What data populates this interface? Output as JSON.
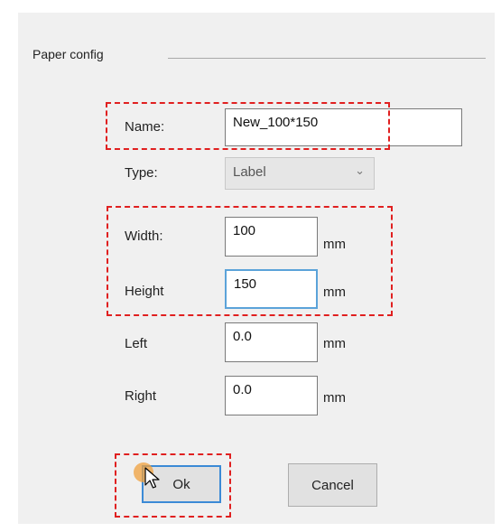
{
  "group": {
    "title": "Paper config"
  },
  "form": {
    "name_label": "Name:",
    "name_value": "New_100*150",
    "type_label": "Type:",
    "type_value": "Label",
    "width_label": "Width:",
    "width_value": "100",
    "height_label": "Height",
    "height_value": "150",
    "left_label": "Left",
    "left_value": "0.0",
    "right_label": "Right",
    "right_value": "0.0",
    "unit": "mm"
  },
  "buttons": {
    "ok": "Ok",
    "cancel": "Cancel"
  },
  "colors": {
    "highlight": "#e02020",
    "focus": "#5ba3d9",
    "cursor": "#f0a03c"
  },
  "icons": {
    "select_arrow": "chevron-down-icon",
    "pointer": "mouse-cursor-icon"
  }
}
